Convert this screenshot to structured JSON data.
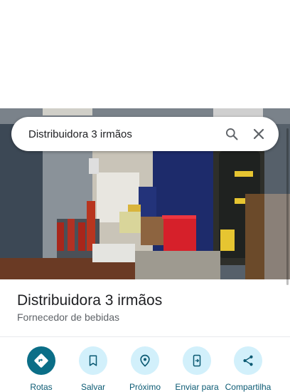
{
  "search": {
    "query": "Distribuidora 3 irmãos",
    "search_icon": "search-icon",
    "close_icon": "close-icon"
  },
  "place": {
    "name": "Distribuidora 3 irmãos",
    "category": "Fornecedor de bebidas"
  },
  "actions": [
    {
      "label": "Rotas",
      "icon": "directions-icon",
      "primary": true
    },
    {
      "label": "Salvar",
      "icon": "bookmark-icon",
      "primary": false
    },
    {
      "label": "Próximo",
      "icon": "nearby-icon",
      "primary": false
    },
    {
      "label": "Enviar para",
      "icon": "send-to-phone-icon",
      "primary": false
    },
    {
      "label": "Compartilha",
      "icon": "share-icon",
      "primary": false
    }
  ],
  "colors": {
    "primary": "#0b6e87",
    "secondary_bg": "#d2f0fb",
    "secondary_fg": "#0b5a73"
  }
}
